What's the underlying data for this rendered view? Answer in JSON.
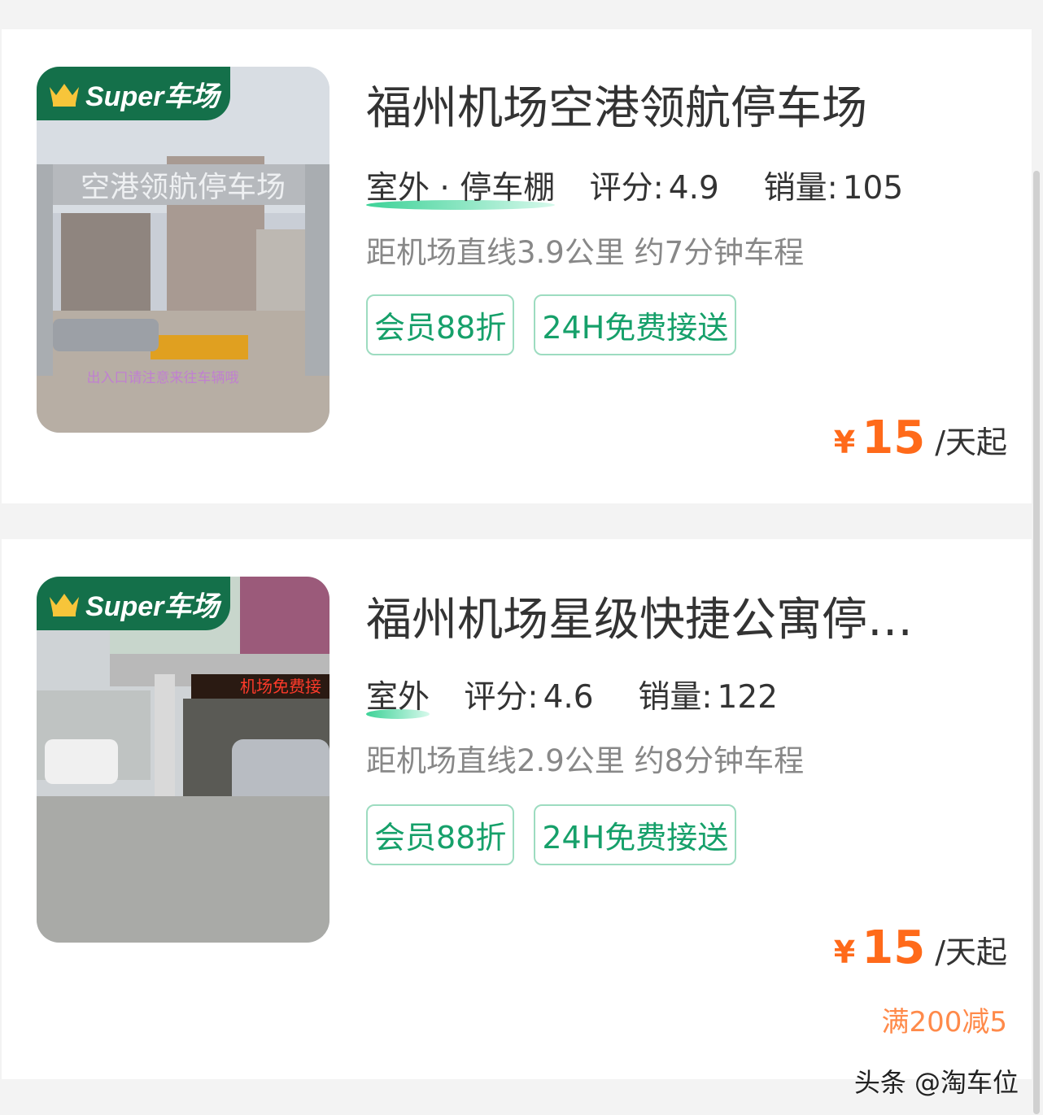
{
  "cards": [
    {
      "badge_text": "Super车场",
      "photo_sign": "空港领航停车场",
      "photo_caption": "出入口请注意来往车辆哦",
      "title": "福州机场空港领航停车场",
      "type": "室外 · 停车棚",
      "rating_label": "评分:",
      "rating": "4.9",
      "sales_label": "销量:",
      "sales": "105",
      "distance": "距机场直线3.9公里 约7分钟车程",
      "tags": [
        "会员88折",
        "24H免费接送"
      ],
      "price_symbol": "¥",
      "price": "15",
      "price_unit": "/天起"
    },
    {
      "badge_text": "Super车场",
      "photo_sign": "机场免费接",
      "title": "福州机场星级快捷公寓停…",
      "type": "室外",
      "rating_label": "评分:",
      "rating": "4.6",
      "sales_label": "销量:",
      "sales": "122",
      "distance": "距机场直线2.9公里 约8分钟车程",
      "tags": [
        "会员88折",
        "24H免费接送"
      ],
      "price_symbol": "¥",
      "price": "15",
      "price_unit": "/天起",
      "promo": "满200减5"
    }
  ],
  "watermark": "头条 @淘车位",
  "colors": {
    "accent_green": "#16a06a",
    "badge_green": "#14704a",
    "price_orange": "#ff6a1a",
    "promo_orange": "#ff8a4a"
  }
}
